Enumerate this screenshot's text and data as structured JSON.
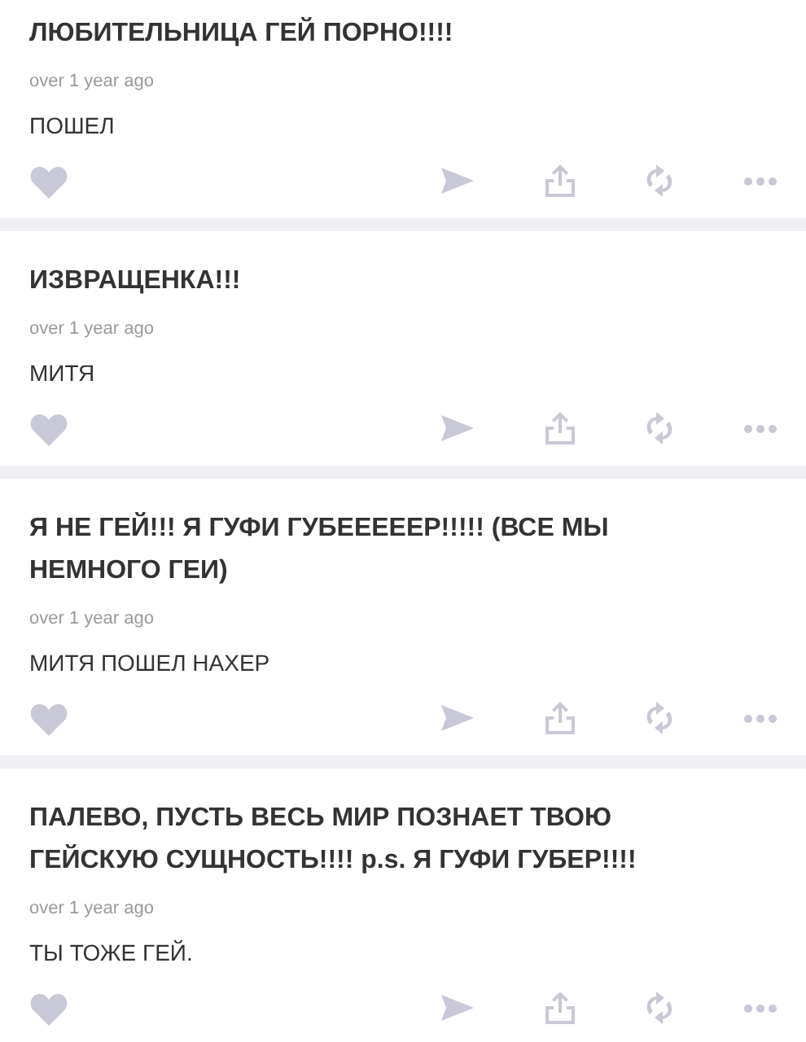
{
  "posts": [
    {
      "question": "ЛЮБИТЕЛЬНИЦА ГЕЙ ПОРНО!!!!",
      "time": "over 1 year ago",
      "answer": "ПОШЕЛ"
    },
    {
      "question": "ИЗВРАЩЕНКА!!!",
      "time": "over 1 year ago",
      "answer": "МИТЯ"
    },
    {
      "question": "Я НЕ ГЕЙ!!! Я ГУФИ ГУБЕЕЕЕЕР!!!!! (ВСЕ МЫ НЕМНОГО ГЕИ)",
      "time": "over 1 year ago",
      "answer": "МИТЯ ПОШЕЛ НАХЕР"
    },
    {
      "question": "ПАЛЕВО, ПУСТЬ ВЕСЬ МИР ПОЗНАЕТ ТВОЮ ГЕЙСКУЮ СУЩНОСТЬ!!!! p.s. Я ГУФИ ГУБЕР!!!!",
      "time": "over 1 year ago",
      "answer": "ТЫ ТОЖЕ ГЕЙ."
    }
  ]
}
